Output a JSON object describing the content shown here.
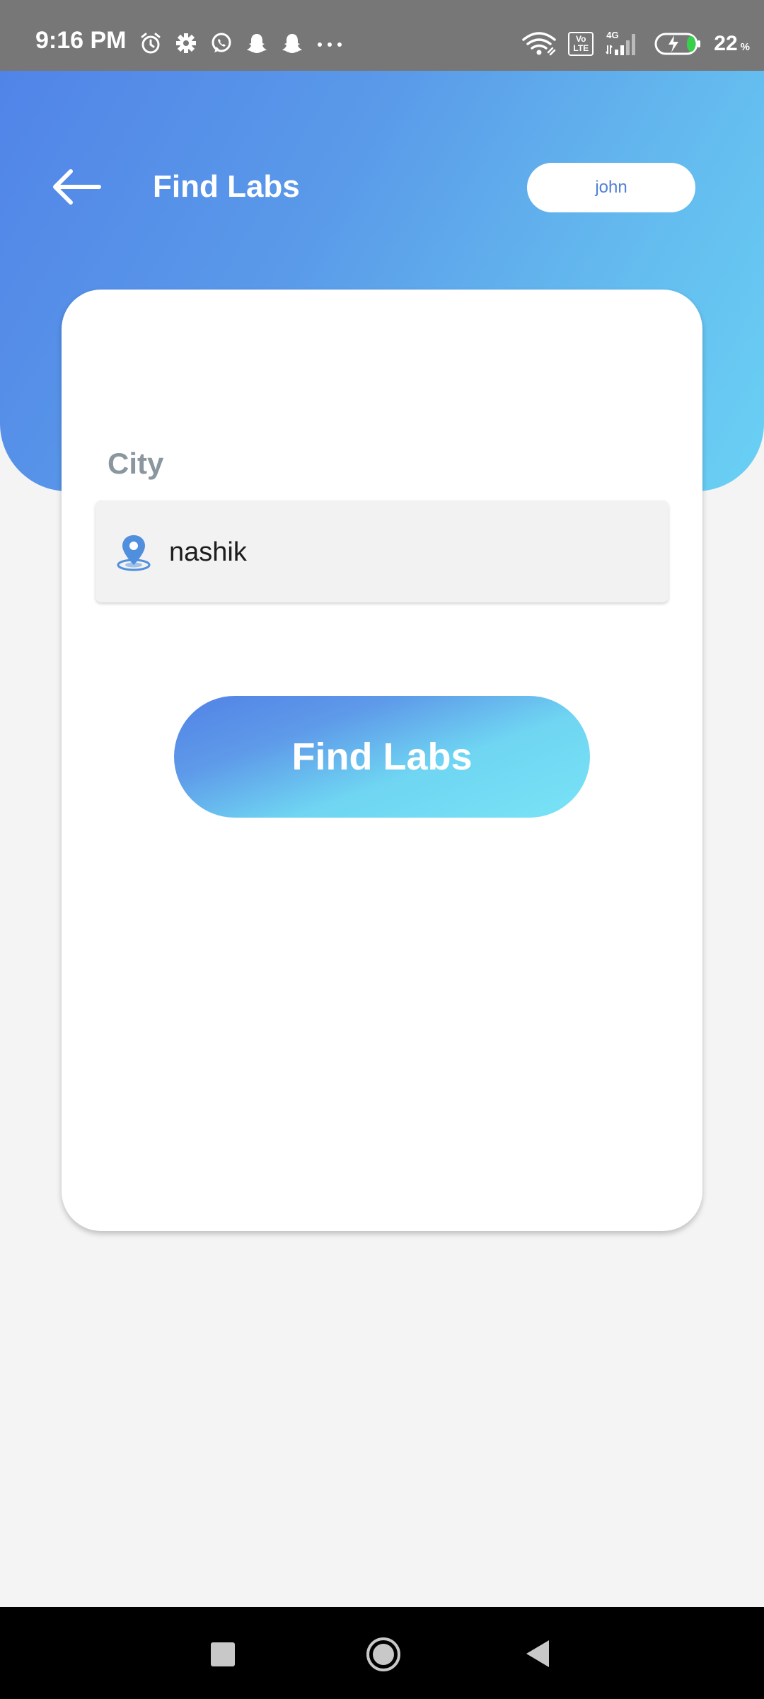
{
  "status_bar": {
    "time": "9:16 PM",
    "left_icons": [
      "alarm-icon",
      "settings-icon",
      "whatsapp-icon",
      "snapchat-icon",
      "snapchat-icon",
      "more-dots-icon"
    ],
    "volte_label": "Vo LTE",
    "network_label": "4G",
    "battery_percent": "22",
    "battery_percent_sign": "%",
    "battery_level": 0.22,
    "battery_charging": true
  },
  "header": {
    "title": "Find Labs",
    "back_icon": "arrow-left-icon",
    "user_name": "john"
  },
  "form": {
    "city_label": "City",
    "city_icon": "location-pin-icon",
    "city_value": "nashik"
  },
  "actions": {
    "find_labs_label": "Find Labs"
  },
  "nav_bar": {
    "buttons": [
      "recent-apps-icon",
      "home-icon",
      "back-triangle-icon"
    ]
  },
  "colors": {
    "header_gradient_start": "#5184e8",
    "header_gradient_end": "#6ad1f4",
    "button_gradient_start": "#5282e6",
    "button_gradient_end": "#78e3f6",
    "user_text": "#4f7fd6",
    "label_gray": "#8a979e",
    "page_background": "#f4f4f4"
  }
}
